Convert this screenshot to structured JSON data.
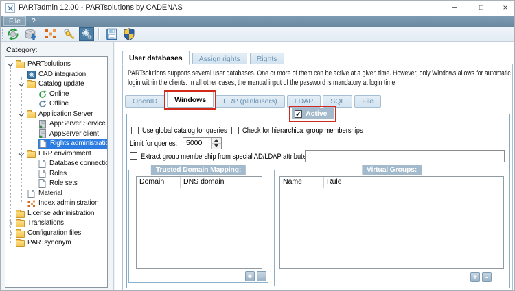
{
  "window": {
    "title": "PARTadmin 12.00 - PARTsolutions by CADENAS",
    "controls": {
      "minimize": "─",
      "maximize": "□",
      "close": "×"
    }
  },
  "menubar": {
    "items": [
      {
        "label": "File"
      },
      {
        "label": "?"
      }
    ]
  },
  "toolbar": {
    "icons": [
      "update-icon",
      "catalog-discs-icon",
      "index-administration-icon",
      "keys-icon",
      "settings-pressed-icon",
      "save-icon",
      "admin-shield-icon"
    ]
  },
  "sidebar": {
    "label": "Category:",
    "tree": [
      {
        "label": "PARTsolutions",
        "depth": 0,
        "icon": "folder",
        "expander": "expanded"
      },
      {
        "label": "CAD integration",
        "depth": 1,
        "icon": "cad-integration"
      },
      {
        "label": "Catalog update",
        "depth": 1,
        "icon": "folder",
        "expander": "expanded"
      },
      {
        "label": "Online",
        "depth": 2,
        "icon": "refresh-green"
      },
      {
        "label": "Offline",
        "depth": 2,
        "icon": "refresh-gray"
      },
      {
        "label": "Application Server",
        "depth": 1,
        "icon": "folder",
        "expander": "expanded"
      },
      {
        "label": "AppServer Service",
        "depth": 2,
        "icon": "server"
      },
      {
        "label": "AppServer client",
        "depth": 2,
        "icon": "server"
      },
      {
        "label": "Rights administration",
        "depth": 2,
        "icon": "document",
        "selected": true
      },
      {
        "label": "ERP environment",
        "depth": 1,
        "icon": "folder",
        "expander": "expanded"
      },
      {
        "label": "Database connection",
        "depth": 2,
        "icon": "document"
      },
      {
        "label": "Roles",
        "depth": 2,
        "icon": "document"
      },
      {
        "label": "Role sets",
        "depth": 2,
        "icon": "document"
      },
      {
        "label": "Material",
        "depth": 1,
        "icon": "document"
      },
      {
        "label": "Index administration",
        "depth": 1,
        "icon": "index"
      },
      {
        "label": "License administration",
        "depth": 0,
        "icon": "folder"
      },
      {
        "label": "Translations",
        "depth": 0,
        "icon": "folder",
        "expander": "collapsed"
      },
      {
        "label": "Configuration files",
        "depth": 0,
        "icon": "folder",
        "expander": "collapsed"
      },
      {
        "label": "PARTsynonym",
        "depth": 0,
        "icon": "folder"
      }
    ]
  },
  "main": {
    "tabs": [
      {
        "label": "User databases",
        "active": true
      },
      {
        "label": "Assign rights",
        "active": false
      },
      {
        "label": "Rights",
        "active": false
      }
    ],
    "description": "PARTsolutions supports several user databases. One or more of them can be active at a given time. However, only Windows allows for automatic login within the clients. In all other cases, the manual input of the password is mandatory at login time.",
    "subtabs": [
      {
        "label": "OpenID",
        "active": false
      },
      {
        "label": "Windows",
        "active": true,
        "annotated": true
      },
      {
        "label": "ERP (plinkusers)",
        "active": false
      },
      {
        "label": "LDAP",
        "active": false
      },
      {
        "label": "SQL",
        "active": false
      },
      {
        "label": "File",
        "active": false
      }
    ],
    "windows_tab": {
      "active_checkbox": {
        "label": "Active",
        "checked": true,
        "annotated": true
      },
      "use_global_catalog": {
        "label": "Use global catalog for queries",
        "checked": false
      },
      "hierarchical_groups": {
        "label": "Check for hierarchical group memberships",
        "checked": false
      },
      "limit": {
        "label": "Limit for queries:",
        "value": "5000"
      },
      "extract": {
        "label": "Extract group membership from special AD/LDAP attribute:",
        "checked": false,
        "value": ""
      },
      "trusted_domain_mapping": {
        "title": "Trusted Domain Mapping:",
        "columns": [
          "Domain",
          "DNS domain"
        ],
        "rows": [],
        "add_label": "+",
        "remove_label": "-"
      },
      "virtual_groups": {
        "title": "Virtual Groups:",
        "columns": [
          "Name",
          "Rule"
        ],
        "rows": [],
        "add_label": "+",
        "remove_label": "-"
      }
    }
  },
  "colors": {
    "selection_blue": "#2b7ce2",
    "annotation_red": "#d22a1a",
    "chip_background": "#a3bacc",
    "tab_border": "#a5c0d6",
    "group_border": "#83aac5",
    "menubar_blue": "#7595ad",
    "folder_yellow": "#f3c24f"
  }
}
